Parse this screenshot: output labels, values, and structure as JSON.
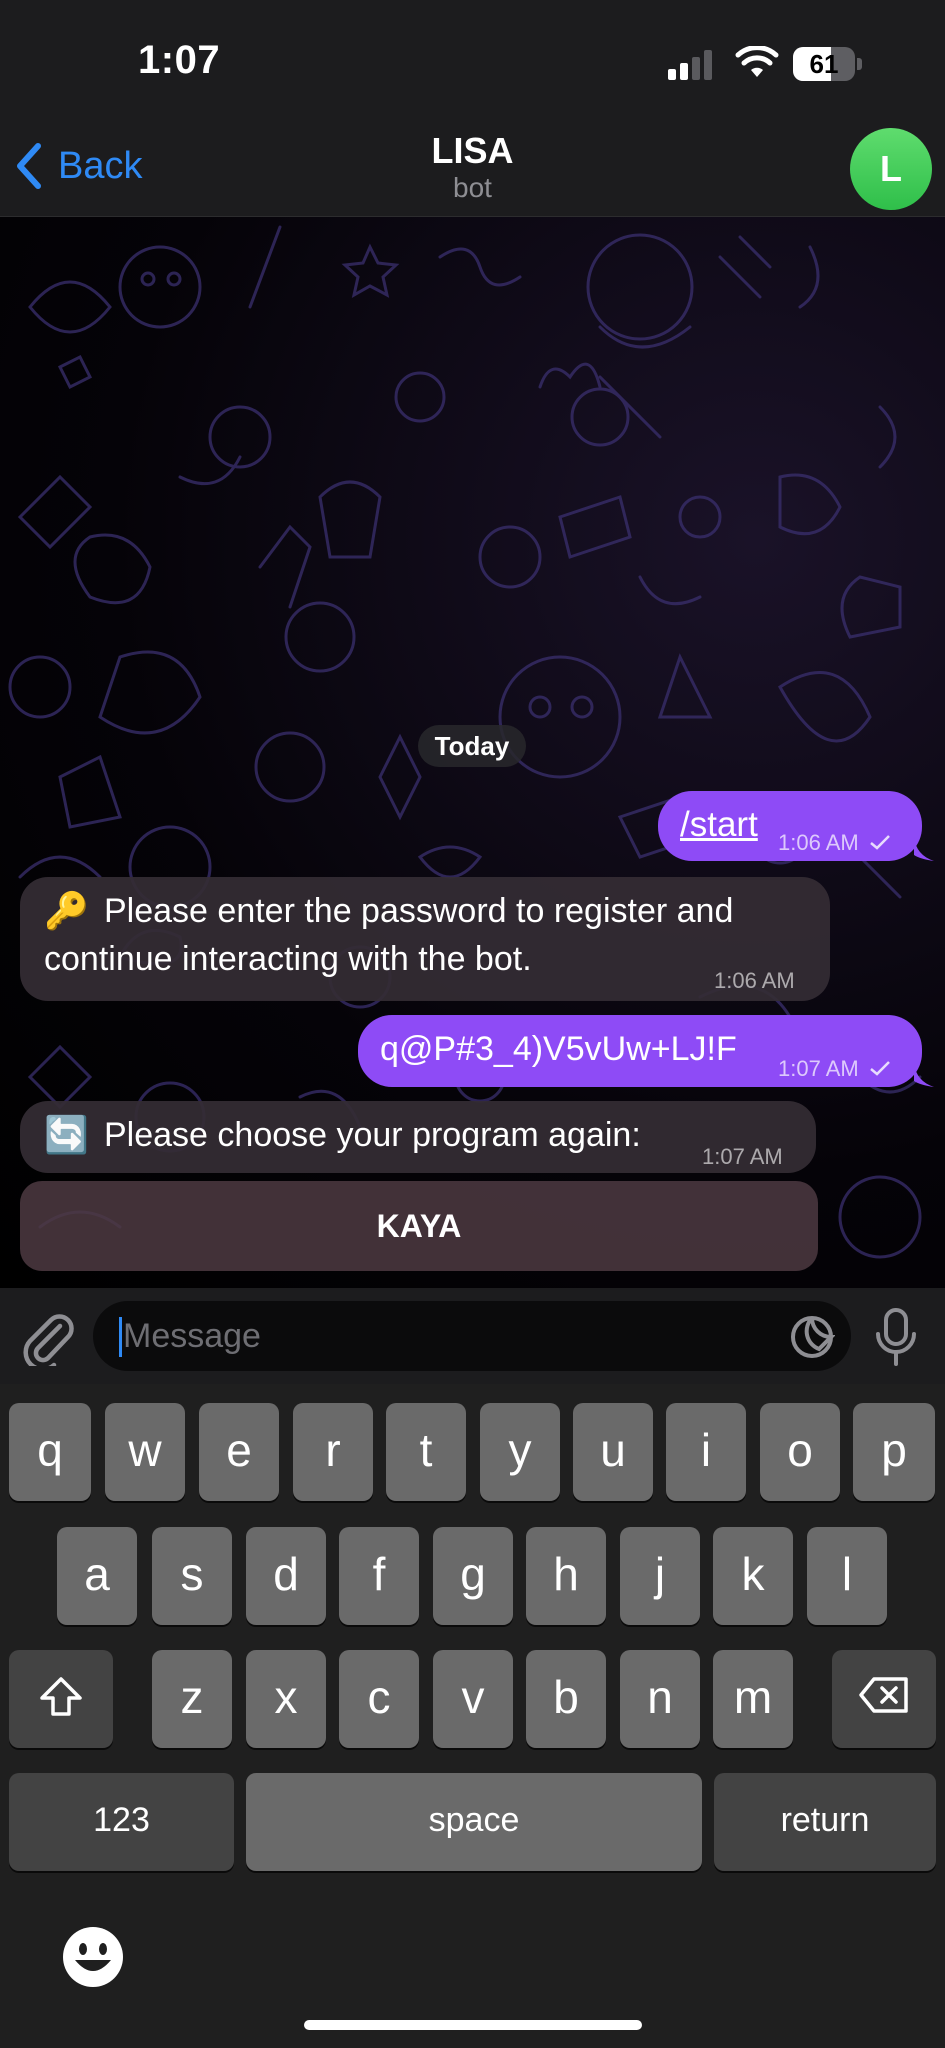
{
  "status_bar": {
    "time": "1:07",
    "battery": "61",
    "battery_level": 0.61
  },
  "nav": {
    "back_label": "Back",
    "title": "LISA",
    "subtitle": "bot",
    "avatar_letter": "L"
  },
  "chat": {
    "date_label": "Today",
    "messages": [
      {
        "direction": "out",
        "text": "/start",
        "time": "1:06 AM",
        "read": true
      },
      {
        "direction": "in",
        "emoji": "🔑",
        "text_line1": "Please enter the password to register and",
        "text_line2": "continue interacting with the bot.",
        "time": "1:06 AM"
      },
      {
        "direction": "out",
        "text": "q@P#3_4)V5vUw+LJ!F",
        "time": "1:07 AM",
        "read": true
      },
      {
        "direction": "in",
        "emoji": "🔄",
        "text": "Please choose your program again:",
        "time": "1:07 AM"
      }
    ],
    "inline_keyboard": [
      "KAYA"
    ]
  },
  "input": {
    "placeholder": "Message"
  },
  "keyboard": {
    "row1": [
      "q",
      "w",
      "e",
      "r",
      "t",
      "y",
      "u",
      "i",
      "o",
      "p"
    ],
    "row2": [
      "a",
      "s",
      "d",
      "f",
      "g",
      "h",
      "j",
      "k",
      "l"
    ],
    "row3": [
      "z",
      "x",
      "c",
      "v",
      "b",
      "n",
      "m"
    ],
    "numbers_label": "123",
    "space_label": "space",
    "return_label": "return"
  },
  "colors": {
    "accent": "#2f8af5",
    "outgoing_bubble": "#8e4bf6",
    "avatar": "#34c759"
  }
}
